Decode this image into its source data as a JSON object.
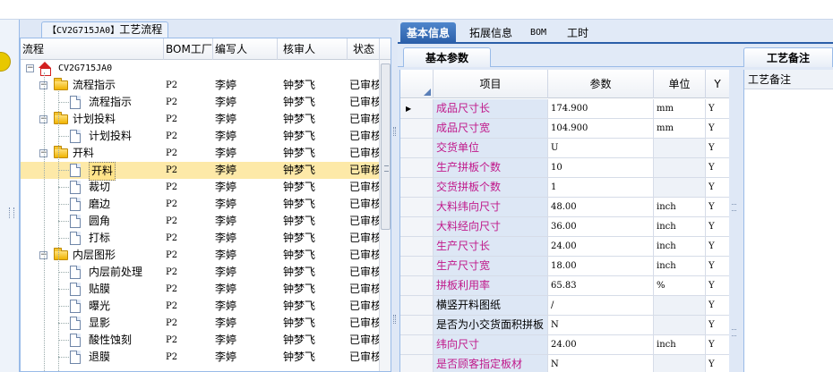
{
  "tree_panel": {
    "tab_code": "【CV2G715JA0】",
    "tab_label": "工艺流程",
    "columns": [
      "流程",
      "BOM工厂",
      "编写人",
      "核审人",
      "状态"
    ],
    "rows": [
      {
        "name": "CV2G715JA0",
        "kind": "root",
        "bom": "",
        "author": "",
        "reviewer": "",
        "status": ""
      },
      {
        "name": "流程指示",
        "kind": "folder",
        "bom": "P2",
        "author": "李婷",
        "reviewer": "钟梦飞",
        "status": "已审核"
      },
      {
        "name": "流程指示",
        "kind": "doc",
        "bom": "P2",
        "author": "李婷",
        "reviewer": "钟梦飞",
        "status": "已审核"
      },
      {
        "name": "计划投料",
        "kind": "folder",
        "bom": "P2",
        "author": "李婷",
        "reviewer": "钟梦飞",
        "status": "已审核"
      },
      {
        "name": "计划投料",
        "kind": "doc",
        "bom": "P2",
        "author": "李婷",
        "reviewer": "钟梦飞",
        "status": "已审核"
      },
      {
        "name": "开料",
        "kind": "folder",
        "bom": "P2",
        "author": "李婷",
        "reviewer": "钟梦飞",
        "status": "已审核"
      },
      {
        "name": "开料",
        "kind": "doc",
        "bom": "P2",
        "author": "李婷",
        "reviewer": "钟梦飞",
        "status": "已审核",
        "selected": true
      },
      {
        "name": "裁切",
        "kind": "doc",
        "bom": "P2",
        "author": "李婷",
        "reviewer": "钟梦飞",
        "status": "已审核"
      },
      {
        "name": "磨边",
        "kind": "doc",
        "bom": "P2",
        "author": "李婷",
        "reviewer": "钟梦飞",
        "status": "已审核"
      },
      {
        "name": "圆角",
        "kind": "doc",
        "bom": "P2",
        "author": "李婷",
        "reviewer": "钟梦飞",
        "status": "已审核"
      },
      {
        "name": "打标",
        "kind": "doc",
        "bom": "P2",
        "author": "李婷",
        "reviewer": "钟梦飞",
        "status": "已审核"
      },
      {
        "name": "内层图形",
        "kind": "folder",
        "bom": "P2",
        "author": "李婷",
        "reviewer": "钟梦飞",
        "status": "已审核"
      },
      {
        "name": "内层前处理",
        "kind": "doc",
        "bom": "P2",
        "author": "李婷",
        "reviewer": "钟梦飞",
        "status": "已审核"
      },
      {
        "name": "贴膜",
        "kind": "doc",
        "bom": "P2",
        "author": "李婷",
        "reviewer": "钟梦飞",
        "status": "已审核"
      },
      {
        "name": "曝光",
        "kind": "doc",
        "bom": "P2",
        "author": "李婷",
        "reviewer": "钟梦飞",
        "status": "已审核"
      },
      {
        "name": "显影",
        "kind": "doc",
        "bom": "P2",
        "author": "李婷",
        "reviewer": "钟梦飞",
        "status": "已审核"
      },
      {
        "name": "酸性蚀刻",
        "kind": "doc",
        "bom": "P2",
        "author": "李婷",
        "reviewer": "钟梦飞",
        "status": "已审核"
      },
      {
        "name": "退膜",
        "kind": "doc",
        "bom": "P2",
        "author": "李婷",
        "reviewer": "钟梦飞",
        "status": "已审核"
      }
    ]
  },
  "main_tabs": [
    "基本信息",
    "拓展信息",
    "BOM",
    "工时"
  ],
  "sub_tab": "基本参数",
  "grid": {
    "columns": [
      "项目",
      "参数",
      "单位",
      "Y"
    ],
    "rows": [
      {
        "item": "成品尺寸长",
        "value": "174.900",
        "unit": "mm",
        "flag": "Y",
        "pink": true
      },
      {
        "item": "成品尺寸宽",
        "value": "104.900",
        "unit": "mm",
        "flag": "Y",
        "pink": true
      },
      {
        "item": "交货单位",
        "value": "U",
        "unit": "",
        "flag": "Y",
        "pink": true
      },
      {
        "item": "生产拼板个数",
        "value": "10",
        "unit": "",
        "flag": "Y",
        "pink": true
      },
      {
        "item": "交货拼板个数",
        "value": "1",
        "unit": "",
        "flag": "Y",
        "pink": true
      },
      {
        "item": "大料纬向尺寸",
        "value": "48.00",
        "unit": "inch",
        "flag": "Y",
        "pink": true
      },
      {
        "item": "大料经向尺寸",
        "value": "36.00",
        "unit": "inch",
        "flag": "Y",
        "pink": true
      },
      {
        "item": "生产尺寸长",
        "value": "24.00",
        "unit": "inch",
        "flag": "Y",
        "pink": true
      },
      {
        "item": "生产尺寸宽",
        "value": "18.00",
        "unit": "inch",
        "flag": "Y",
        "pink": true
      },
      {
        "item": "拼板利用率",
        "value": "65.83",
        "unit": "%",
        "flag": "Y",
        "pink": true
      },
      {
        "item": "横竖开料图纸",
        "value": "/",
        "unit": "",
        "flag": "Y",
        "pink": false
      },
      {
        "item": "是否为小交货面积拼板",
        "value": "N",
        "unit": "",
        "flag": "Y",
        "pink": false
      },
      {
        "item": "纬向尺寸",
        "value": "24.00",
        "unit": "inch",
        "flag": "Y",
        "pink": true
      },
      {
        "item": "是否顾客指定板材",
        "value": "N",
        "unit": "",
        "flag": "Y",
        "pink": true
      }
    ]
  },
  "notes": {
    "tab": "工艺备注",
    "label": "工艺备注"
  },
  "colors": {
    "accent": "#2a5ea8",
    "pink_text": "#c0188a",
    "selected_row": "#fde9a8"
  }
}
